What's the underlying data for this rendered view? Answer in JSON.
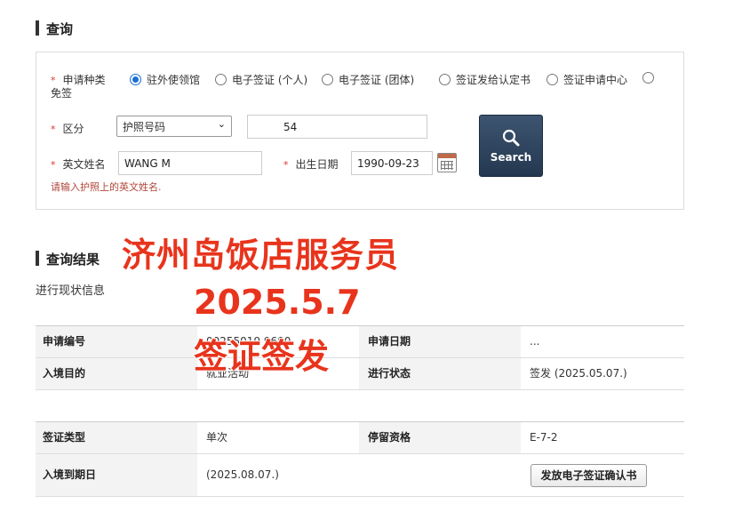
{
  "query": {
    "title": "查询",
    "app_type_label": "申请种类",
    "app_type_options": [
      "驻外使领馆",
      "电子签证 (个人)",
      "电子签证 (团体)",
      "签证发给认定书",
      "签证申请中心",
      "免签"
    ],
    "selected_option": "驻外使领馆",
    "category_label": "区分",
    "category_value": "护照号码",
    "passport_value": "54",
    "name_label": "英文姓名",
    "name_value": "WANG M",
    "dob_label": "出生日期",
    "dob_value": "1990-09-23",
    "hint": "请输入护照上的英文姓名.",
    "search_label": "Search",
    "required_mark": "*"
  },
  "result": {
    "title": "查询结果",
    "subtitle": "进行现状信息",
    "table1": [
      {
        "h1": "申请编号",
        "v1": "00255019 9600",
        "h2": "申请日期",
        "v2": "..."
      },
      {
        "h1": "入境目的",
        "v1": "就业活动",
        "h2": "进行状态",
        "v2": "签发 (2025.05.07.)"
      }
    ],
    "table2": [
      {
        "h1": "签证类型",
        "v1": "单次",
        "h2": "停留资格",
        "v2": "E-7-2"
      },
      {
        "h1": "入境到期日",
        "v1": "(2025.08.07.)",
        "h2": "",
        "v2": ""
      }
    ],
    "confirm_button": "发放电子签证确认书"
  },
  "overlay": {
    "line1": "济州岛饭店服务员",
    "line2": "2025.5.7",
    "line3": "签证签发",
    "color": "#e8341c"
  }
}
